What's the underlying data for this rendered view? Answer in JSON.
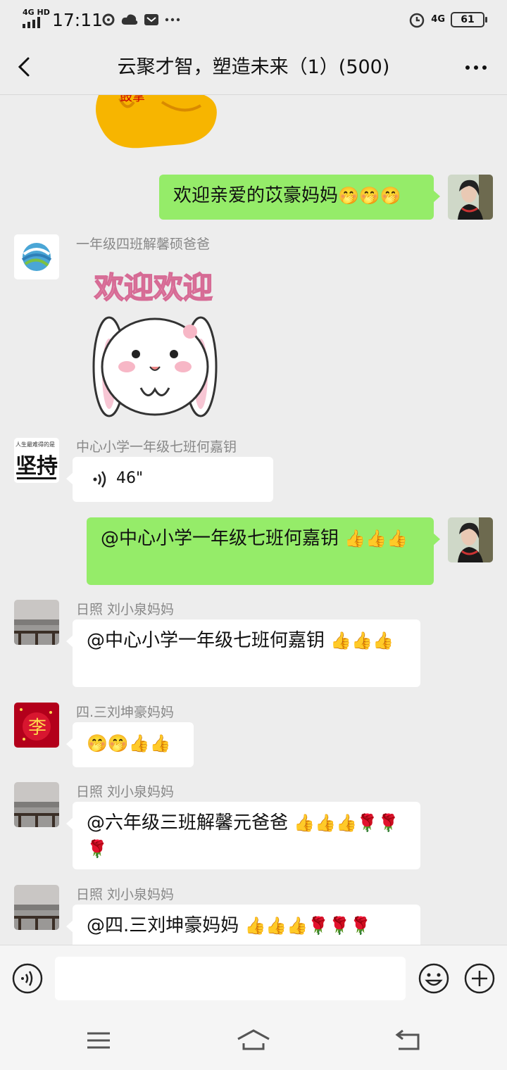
{
  "status_bar": {
    "network": "4G HD",
    "time": "17:11",
    "network_right": "4G",
    "battery": "61"
  },
  "header": {
    "title": "云聚才智，塑造未来（1）(500)"
  },
  "messages": [
    {
      "side": "in",
      "type": "sticker",
      "sticker_text": "鼓掌"
    },
    {
      "side": "out",
      "text": "欢迎亲爱的苡豪妈妈",
      "emoji": "🤭🤭🤭"
    },
    {
      "side": "in",
      "sender": "一年级四班解馨硕爸爸",
      "type": "sticker",
      "sticker_text": "欢迎欢迎"
    },
    {
      "side": "in",
      "sender": "中心小学一年级七班何嘉钥",
      "type": "voice",
      "duration": "46\""
    },
    {
      "side": "out",
      "text": "@中心小学一年级七班何嘉钥 ",
      "emoji": "👍👍👍"
    },
    {
      "side": "in",
      "sender": "日照  刘小泉妈妈",
      "text": "@中心小学一年级七班何嘉钥 ",
      "emoji": "👍👍👍"
    },
    {
      "side": "in",
      "sender": "四.三刘坤豪妈妈",
      "text": "",
      "emoji": "🤭🤭👍👍"
    },
    {
      "side": "in",
      "sender": "日照  刘小泉妈妈",
      "text": "@六年级三班解馨元爸爸 ",
      "emoji": "👍👍👍🌹🌹🌹"
    },
    {
      "side": "in",
      "sender": "日照  刘小泉妈妈",
      "text": "@四.三刘坤豪妈妈 ",
      "emoji": "👍👍👍🌹🌹🌹"
    }
  ],
  "avatar_text": {
    "slogan": "人生最难得的是",
    "big": "坚持",
    "li": "李"
  },
  "colors": {
    "background": "#ededed",
    "outgoing_bubble": "#95ec69",
    "incoming_bubble": "#ffffff"
  },
  "icons": [
    "back-icon",
    "more-icon",
    "voice-icon",
    "emoji-icon",
    "add-icon",
    "menu-icon",
    "home-icon",
    "return-icon"
  ]
}
